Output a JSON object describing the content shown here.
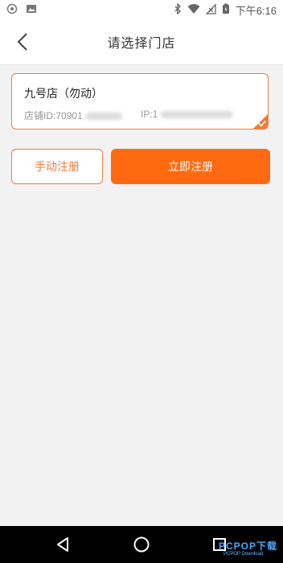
{
  "status_bar": {
    "time": "下午6:16",
    "icons": [
      "settings-icon",
      "image-icon",
      "bluetooth-icon",
      "wifi-icon",
      "signal-icon",
      "battery-icon"
    ]
  },
  "header": {
    "title": "请选择门店",
    "back_icon": "chevron-left-icon"
  },
  "store_card": {
    "name": "九号店（勿动）",
    "id_label": "店铺ID:",
    "id_value": "70901",
    "ip_label": "IP:",
    "ip_value": "1",
    "selected": true,
    "accent": "#f07c3a"
  },
  "buttons": {
    "manual_label": "手动注册",
    "register_label": "立即注册",
    "primary_color": "#ff6a10"
  },
  "nav_bar": {
    "items": [
      "back-triangle-icon",
      "home-circle-icon",
      "recents-square-icon"
    ]
  },
  "watermark": {
    "main": "PCPOP下载",
    "sub": "PCPOP Download"
  }
}
